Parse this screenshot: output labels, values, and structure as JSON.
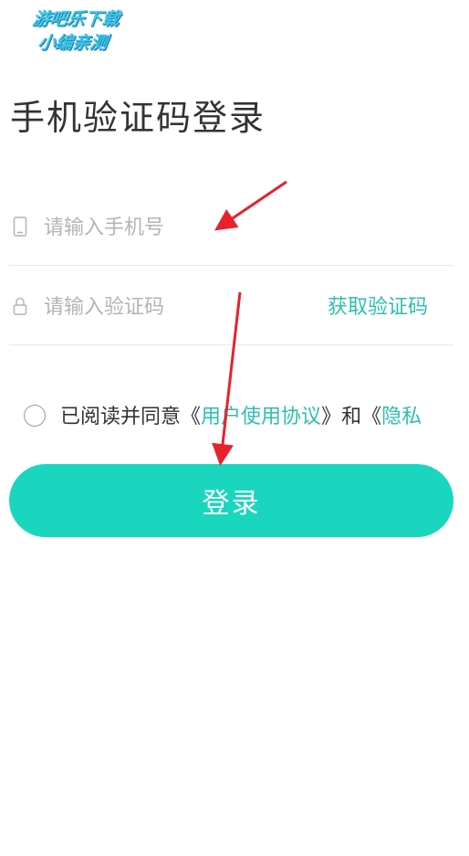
{
  "watermark": {
    "line1": "游吧乐下载",
    "line2": "小编亲测"
  },
  "page": {
    "title": "手机验证码登录"
  },
  "phone_field": {
    "icon": "phone-icon",
    "placeholder": "请输入手机号",
    "value": ""
  },
  "code_field": {
    "icon": "lock-icon",
    "placeholder": "请输入验证码",
    "value": "",
    "get_code_label": "获取验证码"
  },
  "agreement": {
    "checked": false,
    "prefix": "已阅读并同意",
    "open_bracket_1": "《",
    "user_agreement_link": "用户使用协议",
    "close_bracket_1": "》",
    "conjunction": "和",
    "open_bracket_2": "《",
    "privacy_link": "隐私"
  },
  "login_button": {
    "label": "登录"
  },
  "colors": {
    "accent": "#1ad6be",
    "link": "#2dbfae",
    "annotation_arrow": "#e8212b",
    "watermark": "#3cc9e8"
  }
}
